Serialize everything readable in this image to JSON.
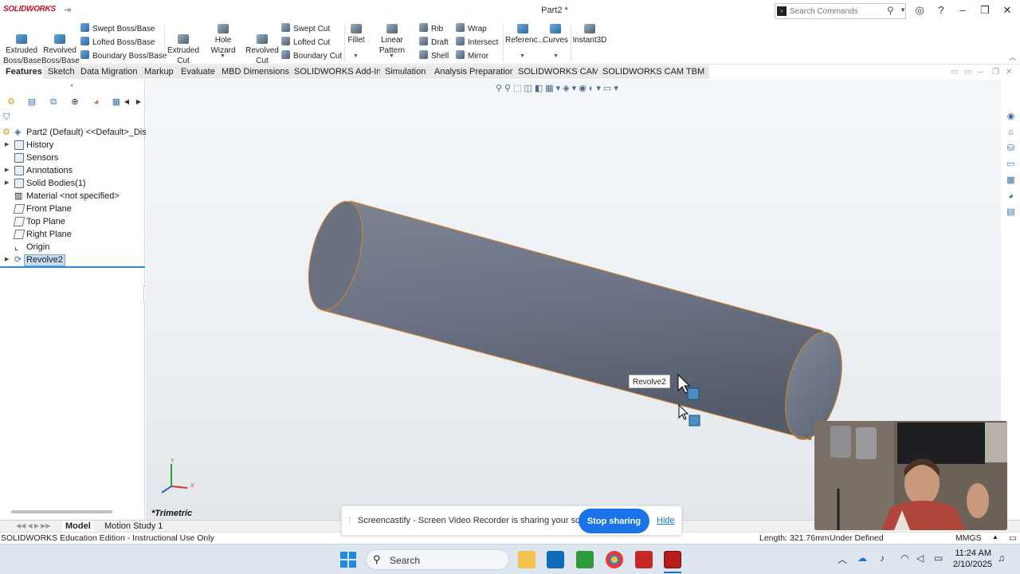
{
  "app": {
    "logo_text": "SOLIDWORKS",
    "document_title": "Part2 *",
    "search_placeholder": "Search Commands"
  },
  "command_manager": {
    "extruded_boss": "Extruded\nBoss/Base",
    "revolved_boss": "Revolved\nBoss/Base",
    "swept_boss": "Swept Boss/Base",
    "lofted_boss": "Lofted Boss/Base",
    "boundary_boss": "Boundary Boss/Base",
    "extruded_cut": "Extruded\nCut",
    "hole_wizard": "Hole Wizard",
    "revolved_cut": "Revolved\nCut",
    "swept_cut": "Swept Cut",
    "lofted_cut": "Lofted Cut",
    "boundary_cut": "Boundary Cut",
    "fillet": "Fillet",
    "linear_pattern": "Linear Pattern",
    "rib": "Rib",
    "draft": "Draft",
    "shell": "Shell",
    "wrap": "Wrap",
    "intersect": "Intersect",
    "mirror": "Mirror",
    "reference": "Referenc...",
    "curves": "Curves",
    "instant3d": "Instant3D"
  },
  "tabs": [
    "Features",
    "Sketch",
    "Data Migration",
    "Markup",
    "Evaluate",
    "MBD Dimensions",
    "SOLIDWORKS Add-Ins",
    "Simulation",
    "Analysis Preparation",
    "SOLIDWORKS CAM",
    "SOLIDWORKS CAM TBM"
  ],
  "feature_tree": {
    "root": "Part2 (Default) <<Default>_Displ",
    "items": [
      {
        "label": "History",
        "expandable": true
      },
      {
        "label": "Sensors",
        "expandable": false
      },
      {
        "label": "Annotations",
        "expandable": true
      },
      {
        "label": "Solid Bodies(1)",
        "expandable": true
      },
      {
        "label": "Material <not specified>",
        "expandable": false
      },
      {
        "label": "Front Plane",
        "expandable": false
      },
      {
        "label": "Top Plane",
        "expandable": false
      },
      {
        "label": "Right Plane",
        "expandable": false
      },
      {
        "label": "Origin",
        "expandable": false
      },
      {
        "label": "Revolve2",
        "expandable": true,
        "selected": true
      }
    ]
  },
  "viewport": {
    "tooltip": "Revolve2",
    "view_name": "*Trimetric",
    "model_color": "#6e7686",
    "edge_color": "#d9822b"
  },
  "bottom_tabs": [
    "Model",
    "Motion Study 1"
  ],
  "status_bar": {
    "edition": "SOLIDWORKS Education Edition - Instructional Use Only",
    "length": "Length: 321.76mm",
    "state": "Under Defined",
    "units": "MMGS"
  },
  "share_bar": {
    "message": "Screencastify - Screen Video Recorder is sharing your screen.",
    "stop_label": "Stop sharing",
    "hide_label": "Hide"
  },
  "taskbar": {
    "search_label": "Search",
    "time": "11:24 AM",
    "date": "2/10/2025"
  }
}
